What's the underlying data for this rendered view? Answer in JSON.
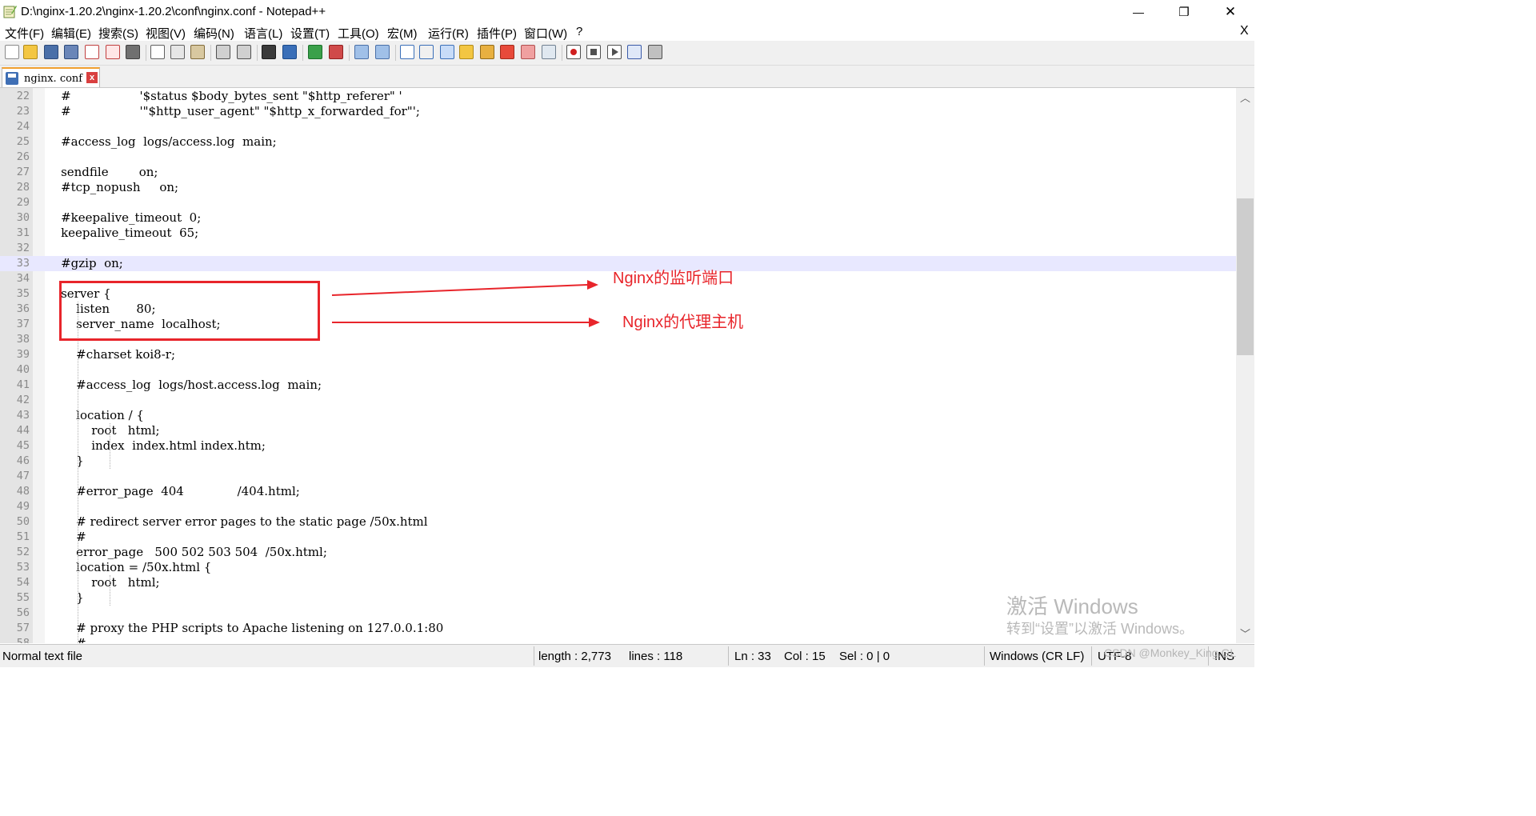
{
  "window": {
    "title": "D:\\nginx-1.20.2\\nginx-1.20.2\\conf\\nginx.conf - Notepad++",
    "minimize_glyph": "—",
    "maximize_glyph": "❐",
    "close_glyph": "✕"
  },
  "menu": {
    "items": [
      "文件(F)",
      "编辑(E)",
      "搜索(S)",
      "视图(V)",
      "编码(N)",
      "语言(L)",
      "设置(T)",
      "工具(O)",
      "宏(M)",
      "运行(R)",
      "插件(P)",
      "窗口(W)",
      "?"
    ],
    "close_doc_glyph": "X"
  },
  "toolbar": {
    "icons": [
      "new-file-icon",
      "open-file-icon",
      "save-icon",
      "save-all-icon",
      "close-icon",
      "close-all-icon",
      "print-icon",
      "cut-icon",
      "copy-icon",
      "paste-icon",
      "undo-icon",
      "redo-icon",
      "find-icon",
      "replace-icon",
      "zoom-in-icon",
      "zoom-out-icon",
      "sync-vertical-icon",
      "sync-horizontal-icon",
      "word-wrap-icon",
      "show-all-chars-icon",
      "indent-guide-icon",
      "doc-map-icon",
      "function-list-icon",
      "folder-workspace-icon",
      "monitoring-icon",
      "record-macro-icon",
      "stop-macro-icon",
      "play-macro-icon",
      "run-macro-multiple-icon",
      "save-macro-icon"
    ]
  },
  "tab": {
    "label": "nginx. conf",
    "close_glyph": "x"
  },
  "editor": {
    "current_line": 33,
    "lines": [
      {
        "num": "22",
        "text": "    #                  '$status $body_bytes_sent \"$http_referer\" '"
      },
      {
        "num": "23",
        "text": "    #                  '\"$http_user_agent\" \"$http_x_forwarded_for\"';"
      },
      {
        "num": "24",
        "text": ""
      },
      {
        "num": "25",
        "text": "    #access_log  logs/access.log  main;"
      },
      {
        "num": "26",
        "text": ""
      },
      {
        "num": "27",
        "text": "    sendfile        on;"
      },
      {
        "num": "28",
        "text": "    #tcp_nopush     on;"
      },
      {
        "num": "29",
        "text": ""
      },
      {
        "num": "30",
        "text": "    #keepalive_timeout  0;"
      },
      {
        "num": "31",
        "text": "    keepalive_timeout  65;"
      },
      {
        "num": "32",
        "text": ""
      },
      {
        "num": "33",
        "text": "    #gzip  on;"
      },
      {
        "num": "34",
        "text": ""
      },
      {
        "num": "35",
        "text": "    server {"
      },
      {
        "num": "36",
        "text": "        listen       80;"
      },
      {
        "num": "37",
        "text": "        server_name  localhost;"
      },
      {
        "num": "38",
        "text": ""
      },
      {
        "num": "39",
        "text": "        #charset koi8-r;"
      },
      {
        "num": "40",
        "text": ""
      },
      {
        "num": "41",
        "text": "        #access_log  logs/host.access.log  main;"
      },
      {
        "num": "42",
        "text": ""
      },
      {
        "num": "43",
        "text": "        location / {"
      },
      {
        "num": "44",
        "text": "            root   html;"
      },
      {
        "num": "45",
        "text": "            index  index.html index.htm;"
      },
      {
        "num": "46",
        "text": "        }"
      },
      {
        "num": "47",
        "text": ""
      },
      {
        "num": "48",
        "text": "        #error_page  404              /404.html;"
      },
      {
        "num": "49",
        "text": ""
      },
      {
        "num": "50",
        "text": "        # redirect server error pages to the static page /50x.html"
      },
      {
        "num": "51",
        "text": "        #"
      },
      {
        "num": "52",
        "text": "        error_page   500 502 503 504  /50x.html;"
      },
      {
        "num": "53",
        "text": "        location = /50x.html {"
      },
      {
        "num": "54",
        "text": "            root   html;"
      },
      {
        "num": "55",
        "text": "        }"
      },
      {
        "num": "56",
        "text": ""
      },
      {
        "num": "57",
        "text": "        # proxy the PHP scripts to Apache listening on 127.0.0.1:80"
      },
      {
        "num": "58",
        "text": "        #"
      }
    ]
  },
  "annotations": {
    "listen_port_label": "Nginx的监听端口",
    "proxy_host_label": "Nginx的代理主机",
    "color": "#e8252b"
  },
  "watermark": {
    "line1": "激活 Windows",
    "line2": "转到“设置”以激活 Windows。",
    "csdn": "CSDN @Monkey_King.GL"
  },
  "statusbar": {
    "file_type": "Normal text file",
    "length": "length : 2,773",
    "lines": "lines : 118",
    "ln": "Ln : 33",
    "col": "Col : 15",
    "sel": "Sel : 0 | 0",
    "eol": "Windows (CR LF)",
    "encoding": "UTF-8",
    "mode": "INS"
  }
}
